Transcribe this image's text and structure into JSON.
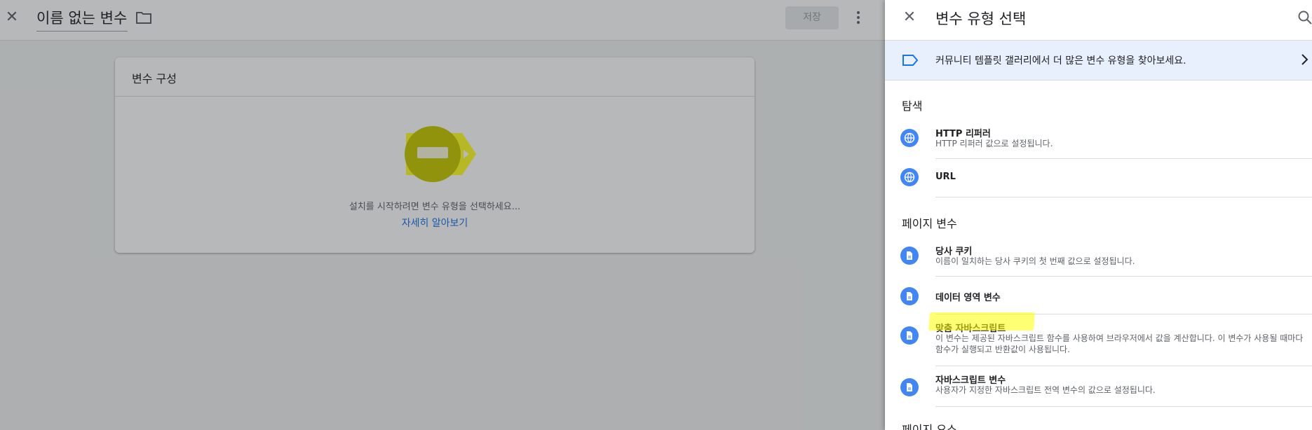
{
  "editor": {
    "variable_name": "이름 없는 변수",
    "save_label": "저장",
    "card": {
      "title": "변수 구성",
      "hint": "설치를 시작하려면 변수 유형을 선택하세요...",
      "link": "자세히 알아보기"
    }
  },
  "panel": {
    "title": "변수 유형 선택",
    "gallery_text": "커뮤니티 템플릿 갤러리에서 더 많은 변수 유형을 찾아보세요.",
    "sections": [
      {
        "title": "탐색",
        "items": [
          {
            "name": "HTTP 리퍼러",
            "desc": "HTTP 리퍼러 값으로 설정됩니다.",
            "icon": "globe-icon"
          },
          {
            "name": "URL",
            "desc": "",
            "icon": "globe-icon"
          }
        ]
      },
      {
        "title": "페이지 변수",
        "items": [
          {
            "name": "당사 쿠키",
            "desc": "이름이 일치하는 당사 쿠키의 첫 번째 값으로 설정됩니다.",
            "icon": "document-icon"
          },
          {
            "name": "데이터 영역 변수",
            "desc": "",
            "icon": "document-icon"
          },
          {
            "name": "맞춤 자바스크립트",
            "desc": "이 변수는 제공된 자바스크립트 함수를 사용하여 브라우저에서 값을 계산합니다. 이 변수가 사용될 때마다 함수가 실행되고 반환값이 사용됩니다.",
            "icon": "document-icon"
          },
          {
            "name": "자바스크립트 변수",
            "desc": "사용자가 지정한 자바스크립트 전역 변수의 값으로 설정됩니다.",
            "icon": "document-icon"
          }
        ]
      },
      {
        "title": "페이지 요소",
        "items": []
      }
    ]
  },
  "colors": {
    "accent": "#1a73e8",
    "icon_blue": "#4285f4",
    "banner_bg": "#e8f0fe",
    "highlight": "#ffff00"
  }
}
